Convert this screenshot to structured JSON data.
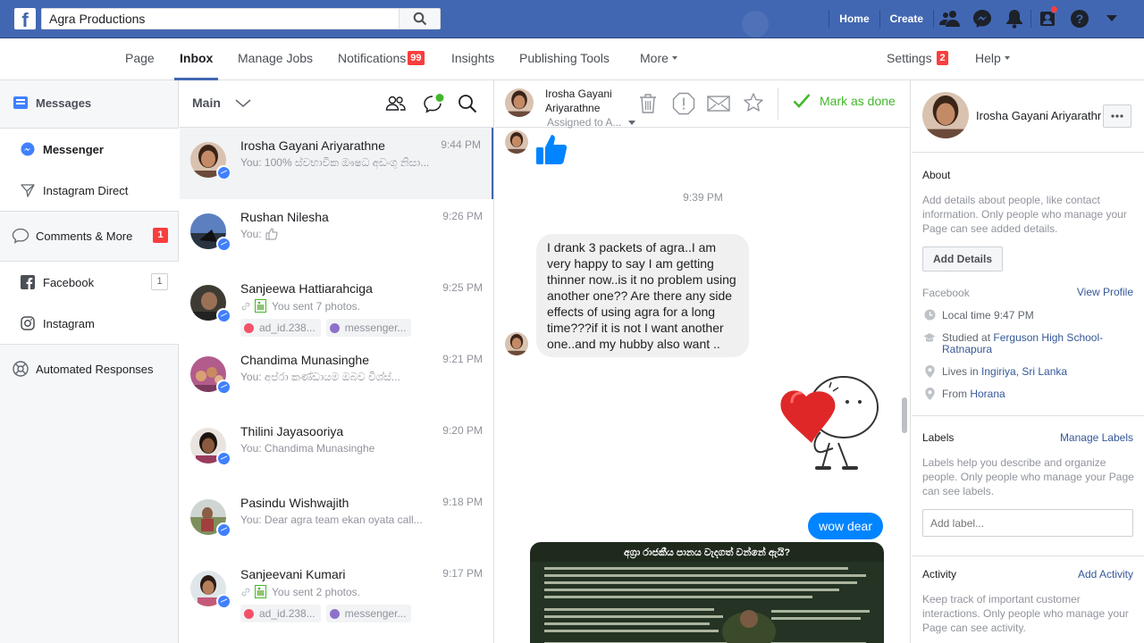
{
  "topbar": {
    "search_value": "Agra Productions",
    "links": [
      "Home",
      "Create"
    ],
    "icons": [
      "friends-icon",
      "messenger-icon",
      "bell-icon",
      "quick-help-icon",
      "help-icon",
      "caret-down-icon"
    ]
  },
  "pagenav": {
    "tabs": [
      {
        "label": "Page"
      },
      {
        "label": "Inbox"
      },
      {
        "label": "Manage Jobs"
      },
      {
        "label": "Notifications",
        "badge": "99"
      },
      {
        "label": "Insights"
      },
      {
        "label": "Publishing Tools"
      },
      {
        "label": "More"
      }
    ],
    "settings_label": "Settings",
    "settings_badge": "2",
    "help_label": "Help",
    "active": "Inbox"
  },
  "leftnav": {
    "messages": "Messages",
    "messenger": "Messenger",
    "instagram_direct": "Instagram Direct",
    "comments": "Comments & More",
    "comments_badge": "1",
    "facebook": "Facebook",
    "facebook_count": "1",
    "instagram": "Instagram",
    "automated": "Automated Responses"
  },
  "convlist": {
    "title": "Main",
    "conversations": [
      {
        "name": "Irosha Gayani Ariyarathne",
        "time": "9:44 PM",
        "preview": "You: 100% ස්වභාවික ඖෂධ අඩංගු නිසා..."
      },
      {
        "name": "Rushan Nilesha",
        "time": "9:26 PM",
        "preview": "You:"
      },
      {
        "name": "Sanjeewa Hattiarahciga",
        "time": "9:25 PM",
        "preview": "You sent 7 photos.",
        "tags": [
          "ad_id.238...",
          "messenger..."
        ]
      },
      {
        "name": "Chandima Munasinghe",
        "time": "9:21 PM",
        "preview": "You: අප්රා කණ්ඩායම ඔබව විශ්ස්..."
      },
      {
        "name": "Thilini Jayasooriya",
        "time": "9:20 PM",
        "preview": "You: Chandima Munasinghe"
      },
      {
        "name": "Pasindu Wishwajith",
        "time": "9:18 PM",
        "preview": "You: Dear agra team ekan oyata call..."
      },
      {
        "name": "Sanjeevani Kumari",
        "time": "9:17 PM",
        "preview": "You sent 2 photos.",
        "tags": [
          "ad_id.238...",
          "messenger..."
        ]
      }
    ]
  },
  "chat": {
    "name": "Irosha Gayani Ariyarathne",
    "assigned": "Assigned to A...",
    "mark_done": "Mark as done",
    "timestamp": "9:39 PM",
    "incoming_message": "I drank 3 packets of agra..I am very happy to say I am getting thinner now..is it no problem using another one?? Are there any side effects of using agra for a long time???if it is not  I want another one..and my hubby also want ..",
    "outgoing_message": "wow dear",
    "poster_title": "අග්‍රා රාජකීය පානය වැදගත් වන්නේ ඇයි?"
  },
  "sidebar": {
    "name": "Irosha Gayani Ariyarathne",
    "about_title": "About",
    "about_text": "Add details about people, like contact information. Only people who manage your Page can see added details.",
    "add_details": "Add Details",
    "facebook_title": "Facebook",
    "view_profile": "View Profile",
    "local_time": "Local time 9:47 PM",
    "studied_prefix": "Studied at",
    "studied_school": "Ferguson High School-Ratnapura",
    "lives_prefix": "Lives in",
    "lives_place": "Ingiriya, Sri Lanka",
    "from_prefix": "From",
    "from_place": "Horana",
    "labels_title": "Labels",
    "manage_labels": "Manage Labels",
    "labels_text": "Labels help you describe and organize people. Only people who manage your Page can see labels.",
    "label_placeholder": "Add label...",
    "activity_title": "Activity",
    "add_activity": "Add Activity",
    "activity_text": "Keep track of important customer interactions. Only people who manage your Page can see activity."
  },
  "colors": {
    "brand": "#4267b2",
    "badge": "#fa3e3e",
    "messenger": "#0084ff",
    "done": "#42b72a"
  }
}
